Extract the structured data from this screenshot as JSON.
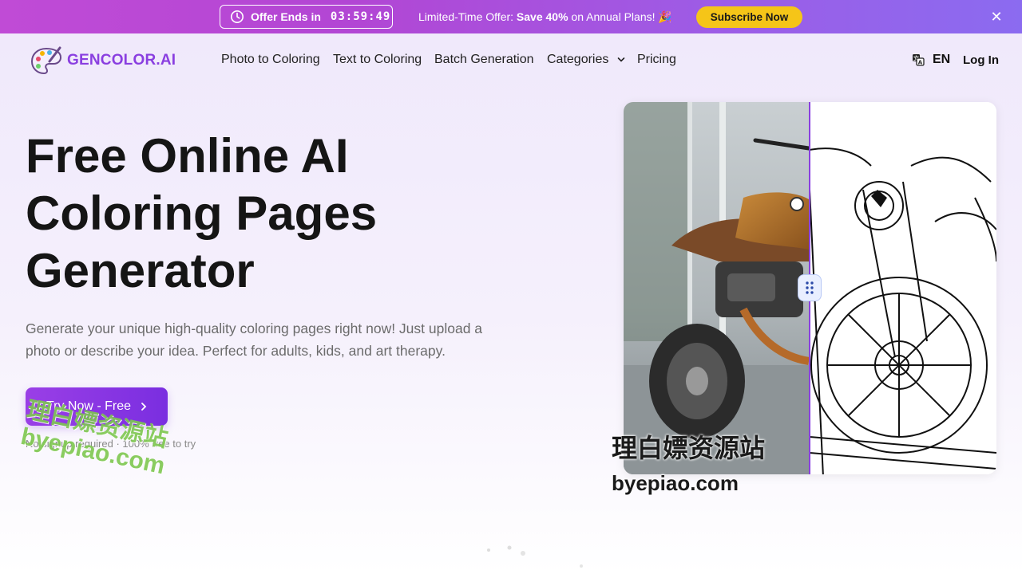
{
  "promo": {
    "timer_label": "Offer Ends in",
    "timer_value": "03:59:49",
    "offer_prefix": "Limited-Time Offer:",
    "offer_bold": "Save 40%",
    "offer_suffix": "on Annual Plans!",
    "offer_emoji": "🎉",
    "subscribe_label": "Subscribe Now",
    "close_glyph": "✕",
    "colors": {
      "banner_start": "#c04bd6",
      "banner_end": "#8b6bf0",
      "button": "#f5c518"
    }
  },
  "header": {
    "logo_text": "GENCOLOR.AI",
    "nav": [
      {
        "label": "Photo to Coloring"
      },
      {
        "label": "Text to Coloring"
      },
      {
        "label": "Batch Generation"
      },
      {
        "label": "Categories"
      },
      {
        "label": "Pricing"
      }
    ],
    "language": "EN",
    "login_label": "Log In",
    "icons": {
      "logo": "palette-icon",
      "language": "translate-icon",
      "categories": "chevron-down-icon"
    }
  },
  "hero": {
    "title_line1": "Free Online AI",
    "title_line2": "Coloring Pages",
    "title_line3": "Generator",
    "subtitle": "Generate your unique high-quality coloring pages right now! Just upload a photo or describe your idea. Perfect for adults, kids, and art therapy.",
    "cta_label": "Try Now - Free",
    "cta_note": "No signup required · 100% free to try",
    "accent_color": "#8a3fe0"
  },
  "compare": {
    "left_image": "motorcycle-photo",
    "right_image": "motorcycle-line-art",
    "handle_icon": "drag-handle-icon"
  },
  "watermark": {
    "cn": "理白嫖资源站",
    "url": "byepiao.com"
  }
}
